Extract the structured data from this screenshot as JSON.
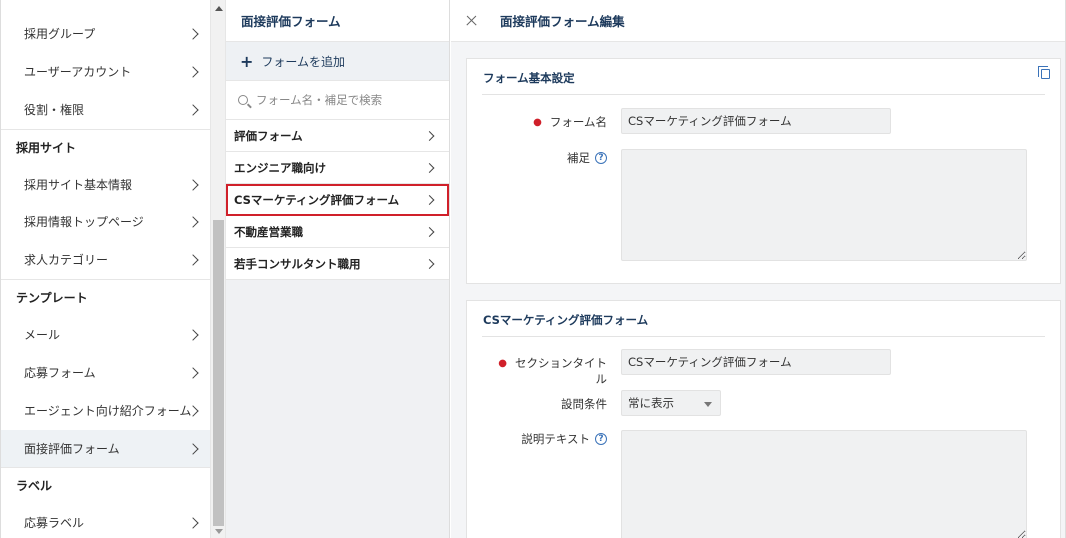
{
  "sidebar": {
    "items": [
      {
        "label": "採用グループ"
      },
      {
        "label": "ユーザーアカウント"
      },
      {
        "label": "役割・権限"
      },
      {
        "label": "採用サイト基本情報"
      },
      {
        "label": "採用情報トップページ"
      },
      {
        "label": "求人カテゴリー"
      },
      {
        "label": "メール"
      },
      {
        "label": "応募フォーム"
      },
      {
        "label": "エージェント向け紹介フォーム"
      },
      {
        "label": "面接評価フォーム"
      },
      {
        "label": "応募ラベル"
      }
    ],
    "headings": [
      {
        "label": "採用サイト"
      },
      {
        "label": "テンプレート"
      },
      {
        "label": "ラベル"
      }
    ],
    "active_item": "面接評価フォーム"
  },
  "middle": {
    "title": "面接評価フォーム",
    "add_label": "フォームを追加",
    "search_placeholder": "フォーム名・補足で検索",
    "forms": [
      {
        "label": "評価フォーム"
      },
      {
        "label": "エンジニア職向け"
      },
      {
        "label": "CSマーケティング評価フォーム"
      },
      {
        "label": "不動産営業職"
      },
      {
        "label": "若手コンサルタント職用"
      }
    ],
    "selected_form": "CSマーケティング評価フォーム"
  },
  "right": {
    "title": "面接評価フォーム編集",
    "basic_card": {
      "title": "フォーム基本設定",
      "name_label": "フォーム名",
      "name_value": "CSマーケティング評価フォーム",
      "note_label": "補足",
      "note_value": ""
    },
    "section_card": {
      "title": "CSマーケティング評価フォーム",
      "section_title_label": "セクションタイトル",
      "section_title_value": "CSマーケティング評価フォーム",
      "condition_label": "設問条件",
      "condition_value": "常に表示",
      "description_label": "説明テキスト",
      "description_value": ""
    }
  },
  "colors": {
    "accent_text": "#1d3a5c",
    "required": "#d0202a",
    "selected_outline": "#d0202a",
    "help_icon": "#3b73b9"
  }
}
